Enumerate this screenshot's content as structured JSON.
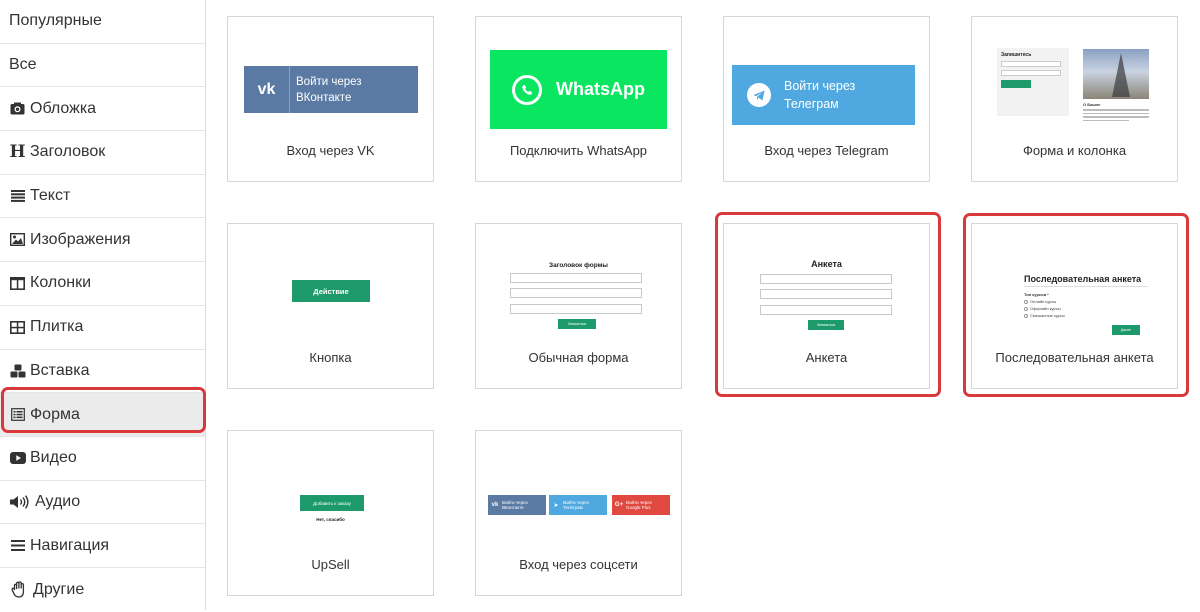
{
  "sidebar": {
    "items": [
      {
        "label": "Популярные",
        "icon": ""
      },
      {
        "label": "Все",
        "icon": ""
      },
      {
        "label": "Обложка",
        "icon": "cover-icon"
      },
      {
        "label": "Заголовок",
        "icon": "heading-icon"
      },
      {
        "label": "Текст",
        "icon": "text-lines-icon"
      },
      {
        "label": "Изображения",
        "icon": "image-icon"
      },
      {
        "label": "Колонки",
        "icon": "columns-icon"
      },
      {
        "label": "Плитка",
        "icon": "tiles-icon"
      },
      {
        "label": "Вставка",
        "icon": "cubes-icon"
      },
      {
        "label": "Форма",
        "icon": "form-icon",
        "active": true
      },
      {
        "label": "Видео",
        "icon": "video-icon"
      },
      {
        "label": "Аудио",
        "icon": "audio-icon"
      },
      {
        "label": "Навигация",
        "icon": "menu-icon"
      },
      {
        "label": "Другие",
        "icon": "hand-icon"
      }
    ]
  },
  "highlight_color": "#d9393a",
  "cards": {
    "vk": {
      "label": "Вход через VK",
      "btn_line1": "Войти через",
      "btn_line2": "ВКонтакте",
      "logo": "vk"
    },
    "whatsapp": {
      "label": "Подключить WhatsApp",
      "btn": "WhatsApp"
    },
    "telegram": {
      "label": "Вход через Telegram",
      "btn_line1": "Войти через",
      "btn_line2": "Телеграм"
    },
    "form_column": {
      "label": "Форма и колонка",
      "form_title": "Запишитесь",
      "text_title": "О Башне"
    },
    "button": {
      "label": "Кнопка",
      "btn": "Действие"
    },
    "simple_form": {
      "label": "Обычная форма",
      "title": "Заголовок формы",
      "btn": "Записаться"
    },
    "anketa": {
      "label": "Анкета",
      "title": "Анкета",
      "btn": "Записаться"
    },
    "sequential": {
      "label": "Последовательная анкета",
      "title": "Последовательная анкета",
      "question": "Тип курсов *",
      "options": [
        "Онлайн курсы",
        "Оффлайн курсы",
        "Смешанные курсы"
      ],
      "btn": "Далее"
    },
    "upsell": {
      "label": "UpSell",
      "btn": "Добавить к заказу",
      "decline": "Нет, спасибо"
    },
    "social": {
      "label": "Вход через соцсети",
      "buttons": [
        {
          "line1": "Войти через",
          "line2": "ВКонтакте",
          "logo": "vk",
          "color": "#5b7aa3"
        },
        {
          "line1": "Войти через",
          "line2": "Телеграм",
          "logo": "➤",
          "color": "#4fa9e0"
        },
        {
          "line1": "Войти через",
          "line2": "Google Plus",
          "logo": "G+",
          "color": "#e0493f"
        }
      ]
    }
  }
}
